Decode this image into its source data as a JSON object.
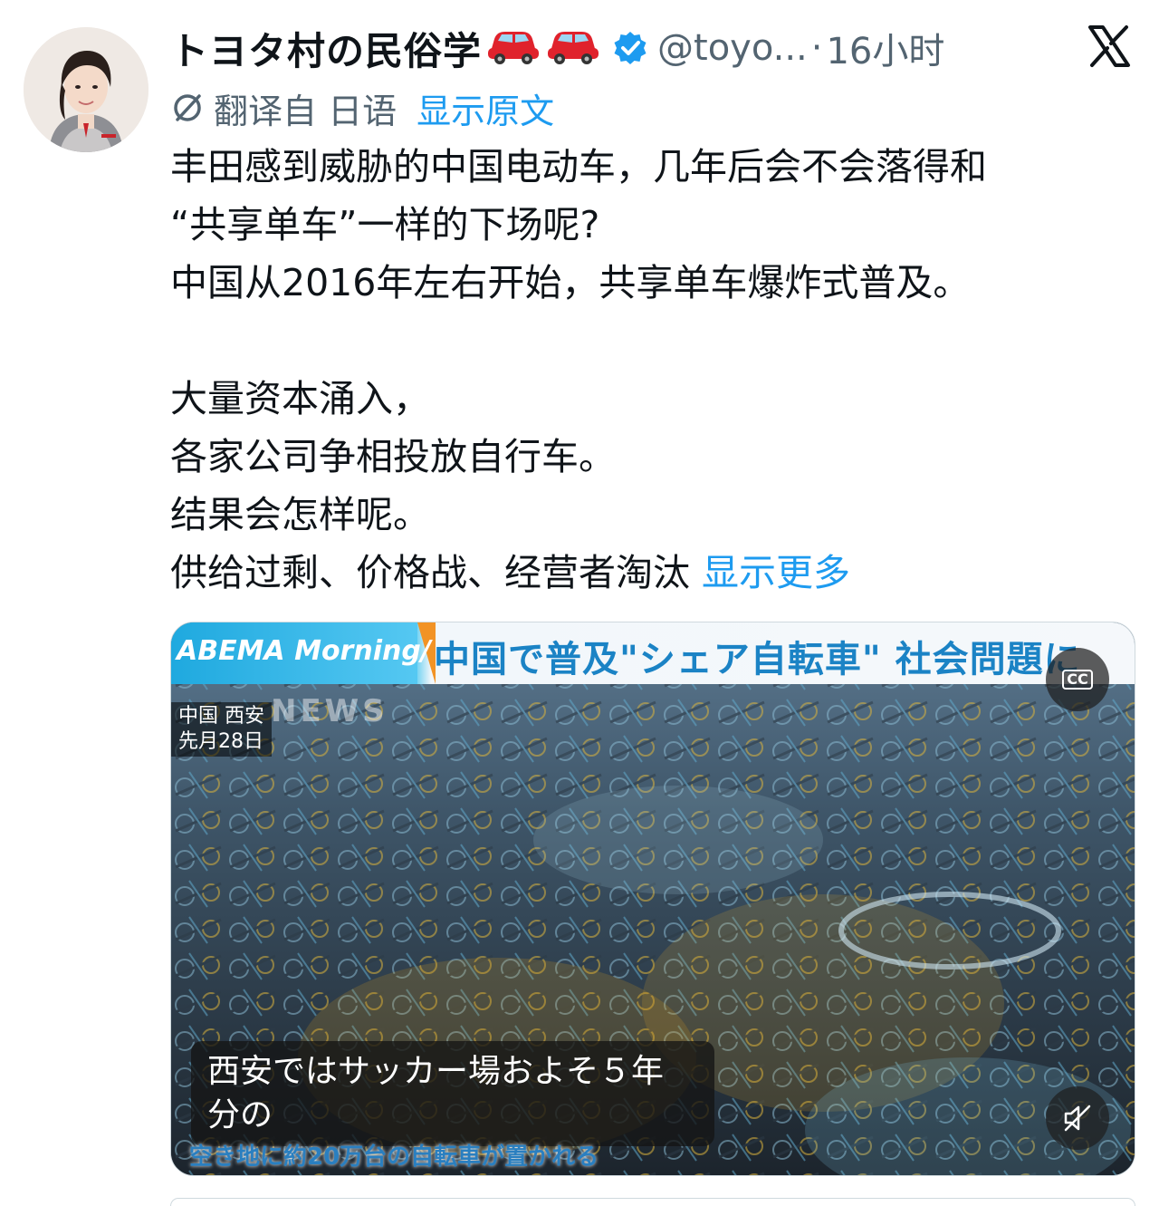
{
  "author": {
    "display_name": "トヨタ村の民俗学",
    "name_emoji": [
      "red-car-emoji",
      "red-car-emoji"
    ],
    "handle": "@toyo...",
    "separator": "·",
    "time": "16小时",
    "verified": true
  },
  "translation": {
    "label": "翻译自 日语",
    "show_original": "显示原文"
  },
  "tweet": {
    "lines": [
      "丰田感到威胁的中国电动车，几年后会不会落得和",
      "“共享单车”一样的下场呢?",
      "中国从2016年左右开始，共享单车爆炸式普及。",
      "",
      "大量资本涌入，",
      "各家公司争相投放自行车。",
      "结果会怎样呢。",
      "供给过剩、价格战、经营者淘汰"
    ],
    "show_more": "显示更多"
  },
  "media": {
    "brand": "ABEMA Morning/",
    "headline": "中国で普及\"シェア自転車\" 社会問題に",
    "watermark": "NEWS",
    "location_line1": "中国 西安",
    "location_line2": "先月28日",
    "cc_label": "CC",
    "caption_line1": "西安ではサッカー場およそ５年",
    "caption_line2": "分の",
    "ticker": "空き地に約20万台の自転車が置かれる"
  },
  "colors": {
    "link": "#1d9bf0",
    "secondary_text": "#536471",
    "verified_badge": "#1d9bf0"
  }
}
